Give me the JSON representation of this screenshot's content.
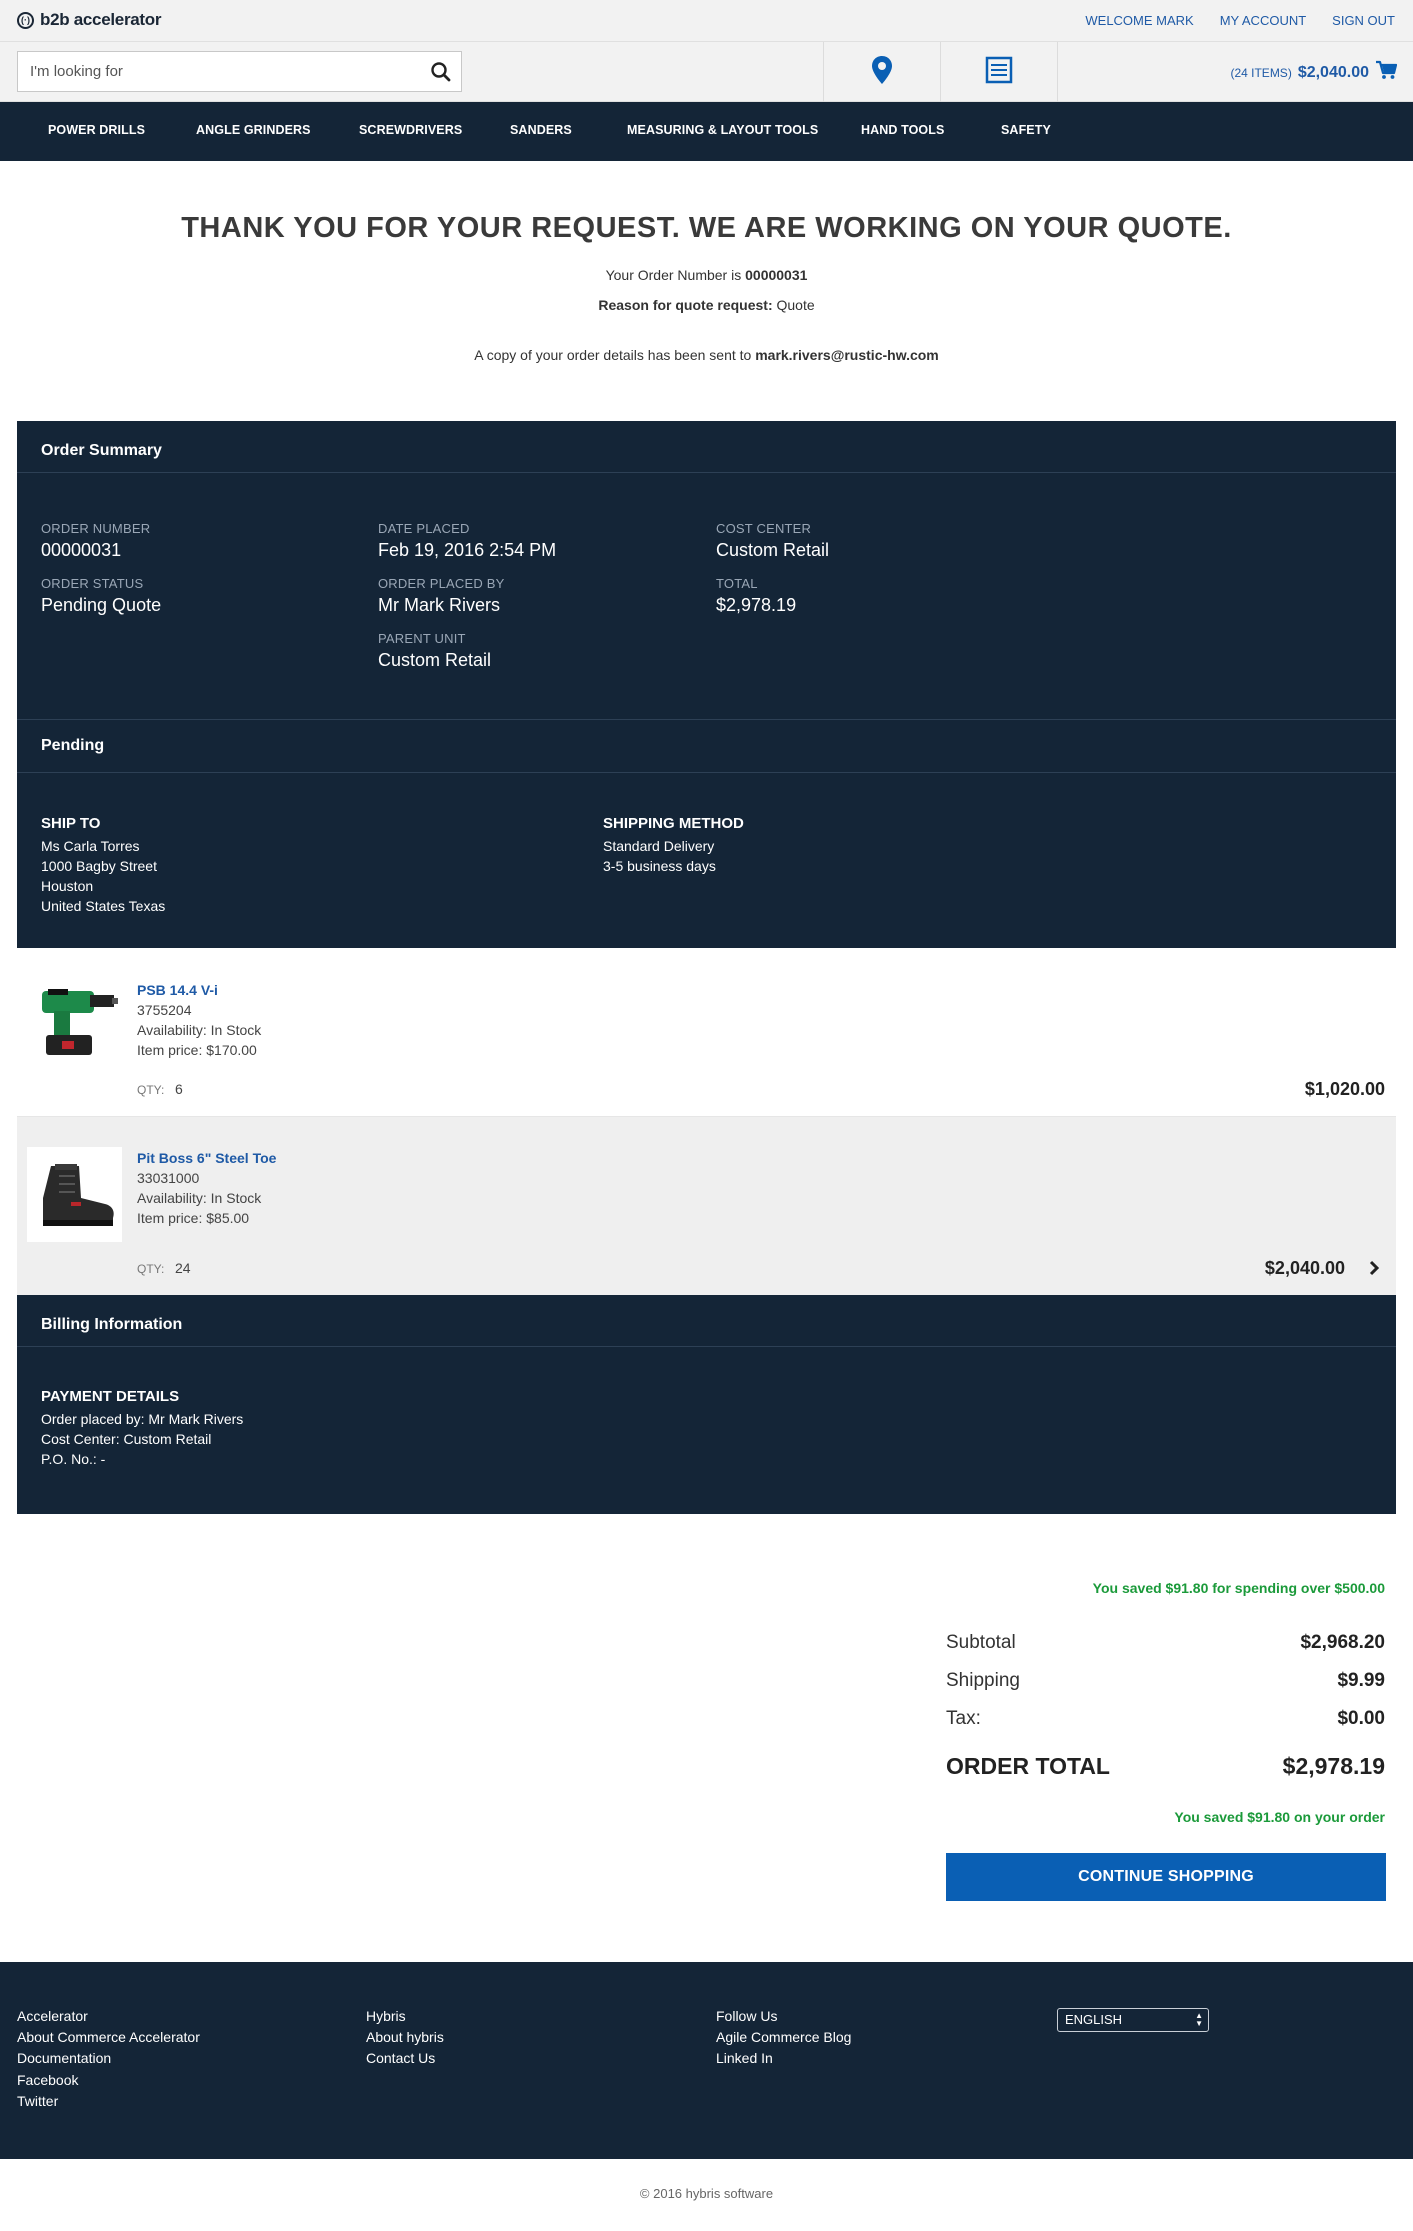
{
  "brand": {
    "logo_mark": "(·)",
    "name": "b2b accelerator"
  },
  "top_links": {
    "welcome": "WELCOME MARK",
    "account": "MY ACCOUNT",
    "signout": "SIGN OUT"
  },
  "search": {
    "placeholder": "I'm looking for"
  },
  "cart": {
    "items": "(24 ITEMS)",
    "total": "$2,040.00"
  },
  "nav": [
    "POWER DRILLS",
    "ANGLE GRINDERS",
    "SCREWDRIVERS",
    "SANDERS",
    "MEASURING & LAYOUT TOOLS",
    "HAND TOOLS",
    "SAFETY"
  ],
  "confirmation": {
    "headline": "THANK YOU FOR YOUR REQUEST. WE ARE WORKING ON YOUR QUOTE.",
    "order_number_prefix": "Your Order Number is ",
    "order_number": "00000031",
    "reason_label": "Reason for quote request:",
    "reason_value": "Quote",
    "copy_prefix": "A copy of your order details has been sent to ",
    "email": "mark.rivers@rustic-hw.com"
  },
  "order_summary": {
    "title": "Order Summary",
    "order_number_label": "ORDER NUMBER",
    "order_number": "00000031",
    "order_status_label": "ORDER STATUS",
    "order_status": "Pending Quote",
    "date_placed_label": "DATE PLACED",
    "date_placed": "Feb 19, 2016 2:54 PM",
    "placed_by_label": "ORDER PLACED BY",
    "placed_by": "Mr Mark Rivers",
    "parent_unit_label": "PARENT UNIT",
    "parent_unit": "Custom Retail",
    "cost_center_label": "COST CENTER",
    "cost_center": "Custom Retail",
    "total_label": "TOTAL",
    "total": "$2,978.19"
  },
  "pending": {
    "title": "Pending",
    "ship_to_label": "SHIP TO",
    "ship_to": [
      "Ms  Carla Torres",
      "1000 Bagby Street",
      "Houston",
      "United States Texas"
    ],
    "shipping_method_label": "SHIPPING METHOD",
    "shipping_method": [
      "Standard Delivery",
      "3-5 business days"
    ]
  },
  "items": [
    {
      "name": "PSB 14.4 V-i",
      "sku": "3755204",
      "availability": "Availability: In Stock",
      "price": "Item price: $170.00",
      "qty_label": "QTY:",
      "qty": "6",
      "total": "$1,020.00"
    },
    {
      "name": "Pit Boss 6\" Steel Toe",
      "sku": "33031000",
      "availability": "Availability: In Stock",
      "price": "Item price: $85.00",
      "qty_label": "QTY:",
      "qty": "24",
      "total": "$2,040.00"
    }
  ],
  "billing": {
    "title": "Billing Information",
    "payment_label": "PAYMENT DETAILS",
    "lines": [
      "Order placed by: Mr Mark Rivers",
      "Cost Center: Custom Retail",
      "P.O. No.: -"
    ]
  },
  "totals": {
    "saved_top": "You saved $91.80 for spending over $500.00",
    "subtotal_label": "Subtotal",
    "subtotal": "$2,968.20",
    "shipping_label": "Shipping",
    "shipping": "$9.99",
    "tax_label": "Tax:",
    "tax": "$0.00",
    "order_total_label": "ORDER TOTAL",
    "order_total": "$2,978.19",
    "saved_bottom": "You saved $91.80 on your order",
    "continue": "CONTINUE SHOPPING"
  },
  "footer": {
    "col1": [
      "Accelerator",
      "About Commerce Accelerator",
      "Documentation",
      "Facebook",
      "Twitter"
    ],
    "col2": [
      "Hybris",
      "About hybris",
      "Contact Us"
    ],
    "col3": [
      "Follow Us",
      "Agile Commerce Blog",
      "Linked In"
    ],
    "language": "ENGLISH",
    "copyright": "© 2016 hybris software"
  },
  "colors": {
    "navy": "#142537",
    "link_blue": "#1f5aa6",
    "button_blue": "#0a5fb4",
    "saved_green": "#1b9a3a"
  },
  "icons": [
    "search-icon",
    "store-locator-pin-icon",
    "quick-order-list-icon",
    "cart-icon",
    "chevron-right-icon",
    "select-arrows-icon"
  ]
}
